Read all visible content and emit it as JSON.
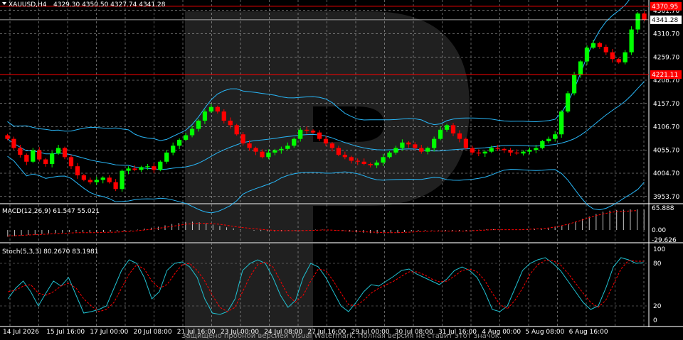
{
  "header": {
    "symbol": "XAUUSD,H4",
    "ohlc": "4329.30 4350.50 4327.74 4341.28"
  },
  "indicators": {
    "macd_title": "MACD(12,26,9) 61.547 55.021",
    "stoch_title": "Stoch(5,3,3) 80.2670 83.1981"
  },
  "watermark": "Защищено пробной версией Visual Watermark. Полная версия не ставит этот значок.",
  "colors": {
    "bull": "#00ff00",
    "bear": "#ff0000",
    "band": "#29b6f6",
    "grid": "#ffffff",
    "signal": "#ff0000",
    "stoch_main": "#20c0d0",
    "stoch_signal": "#ff0000",
    "level_line": "#ff0000"
  },
  "chart_data": [
    {
      "type": "candlestick",
      "title": "XAUUSD,H4",
      "x_ticks": [
        "14 Jul 2026",
        "15 Jul 16:00",
        "17 Jul 00:00",
        "20 Jul 08:00",
        "21 Jul 16:00",
        "23 Jul 00:00",
        "24 Jul 08:00",
        "27 Jul 16:00",
        "29 Jul 00:00",
        "30 Jul 08:00",
        "31 Jul 16:00",
        "4 Aug 00:00",
        "5 Aug 08:00",
        "6 Aug 16:00"
      ],
      "y_ticks": [
        4361.7,
        4310.7,
        4259.7,
        4208.7,
        4157.7,
        4106.7,
        4055.7,
        4004.7,
        3953.7
      ],
      "ylim": [
        3944,
        4380
      ],
      "current_price": 4341.28,
      "level_high": 4370.95,
      "level_low": 4221.11,
      "closes": [
        4080,
        4060,
        4045,
        4030,
        4055,
        4035,
        4025,
        4048,
        4060,
        4040,
        4020,
        4000,
        3990,
        3985,
        3990,
        3995,
        3985,
        3970,
        4010,
        4015,
        4012,
        4018,
        4020,
        4012,
        4030,
        4050,
        4065,
        4078,
        4088,
        4102,
        4120,
        4140,
        4150,
        4140,
        4120,
        4110,
        4090,
        4070,
        4060,
        4052,
        4040,
        4050,
        4055,
        4058,
        4065,
        4080,
        4100,
        4098,
        4094,
        4080,
        4070,
        4060,
        4045,
        4040,
        4032,
        4030,
        4025,
        4022,
        4028,
        4040,
        4050,
        4060,
        4072,
        4068,
        4060,
        4052,
        4060,
        4080,
        4100,
        4110,
        4092,
        4080,
        4060,
        4050,
        4048,
        4052,
        4060,
        4058,
        4055,
        4050,
        4048,
        4052,
        4056,
        4060,
        4075,
        4080,
        4090,
        4140,
        4180,
        4220,
        4250,
        4280,
        4290,
        4282,
        4270,
        4255,
        4248,
        4270,
        4320,
        4355,
        4341
      ],
      "macd": [
        -20,
        -18,
        -16,
        -15,
        -14,
        -12,
        -10,
        -9,
        -8,
        -6,
        -5,
        -6,
        -7,
        -7,
        -6,
        -5,
        -4,
        -3,
        -1,
        1,
        4,
        7,
        10,
        14,
        18,
        21,
        24,
        25,
        23,
        20,
        16,
        12,
        8,
        5,
        2,
        0,
        -2,
        -3,
        -4,
        -4,
        -4,
        -3,
        -2,
        -1,
        0,
        1,
        1,
        0,
        -1,
        -3,
        -5,
        -7,
        -8,
        -9,
        -10,
        -10,
        -9,
        -8,
        -6,
        -4,
        -3,
        -2,
        -1,
        -1,
        -2,
        -3,
        -3,
        -2,
        -1,
        1,
        2,
        2,
        1,
        0,
        0,
        1,
        2,
        3,
        4,
        5,
        8,
        12,
        18,
        25,
        33,
        40,
        48,
        55,
        58,
        60,
        61,
        62,
        62,
        61
      ],
      "macd_signal": [
        -18,
        -17,
        -16,
        -15,
        -14,
        -13,
        -12,
        -11,
        -10,
        -9,
        -8,
        -8,
        -8,
        -8,
        -7,
        -7,
        -6,
        -5,
        -4,
        -2,
        0,
        2,
        5,
        8,
        11,
        14,
        17,
        19,
        20,
        20,
        19,
        17,
        14,
        11,
        8,
        6,
        4,
        2,
        0,
        -1,
        -2,
        -2,
        -2,
        -2,
        -1,
        -1,
        0,
        0,
        -1,
        -2,
        -3,
        -4,
        -5,
        -6,
        -7,
        -8,
        -8,
        -8,
        -7,
        -6,
        -5,
        -4,
        -3,
        -3,
        -3,
        -3,
        -3,
        -3,
        -2,
        -1,
        0,
        1,
        1,
        1,
        1,
        1,
        2,
        3,
        4,
        6,
        9,
        13,
        18,
        24,
        30,
        37,
        43,
        48,
        52,
        55,
        56,
        57,
        58
      ],
      "stoch": [
        30,
        45,
        55,
        40,
        20,
        38,
        55,
        48,
        60,
        35,
        10,
        12,
        15,
        20,
        45,
        70,
        85,
        80,
        60,
        30,
        40,
        70,
        80,
        82,
        75,
        60,
        30,
        10,
        8,
        12,
        30,
        70,
        80,
        85,
        80,
        60,
        35,
        18,
        28,
        60,
        80,
        75,
        60,
        40,
        20,
        12,
        25,
        40,
        50,
        48,
        55,
        62,
        70,
        72,
        65,
        60,
        55,
        50,
        58,
        70,
        75,
        70,
        60,
        40,
        15,
        12,
        20,
        45,
        70,
        80,
        85,
        88,
        80,
        70,
        55,
        40,
        25,
        15,
        20,
        45,
        75,
        88,
        85,
        80,
        81
      ],
      "stoch_signal": [
        40,
        42,
        48,
        50,
        38,
        35,
        40,
        48,
        52,
        45,
        30,
        20,
        12,
        15,
        25,
        45,
        65,
        78,
        72,
        55,
        45,
        50,
        65,
        78,
        80,
        70,
        55,
        35,
        18,
        12,
        18,
        40,
        62,
        78,
        82,
        75,
        55,
        35,
        25,
        35,
        55,
        72,
        70,
        55,
        38,
        22,
        20,
        28,
        38,
        45,
        50,
        55,
        62,
        68,
        68,
        64,
        58,
        54,
        55,
        62,
        70,
        72,
        68,
        56,
        38,
        22,
        16,
        28,
        45,
        65,
        78,
        84,
        84,
        78,
        66,
        52,
        38,
        25,
        18,
        28,
        50,
        72,
        84,
        83,
        83
      ]
    }
  ]
}
